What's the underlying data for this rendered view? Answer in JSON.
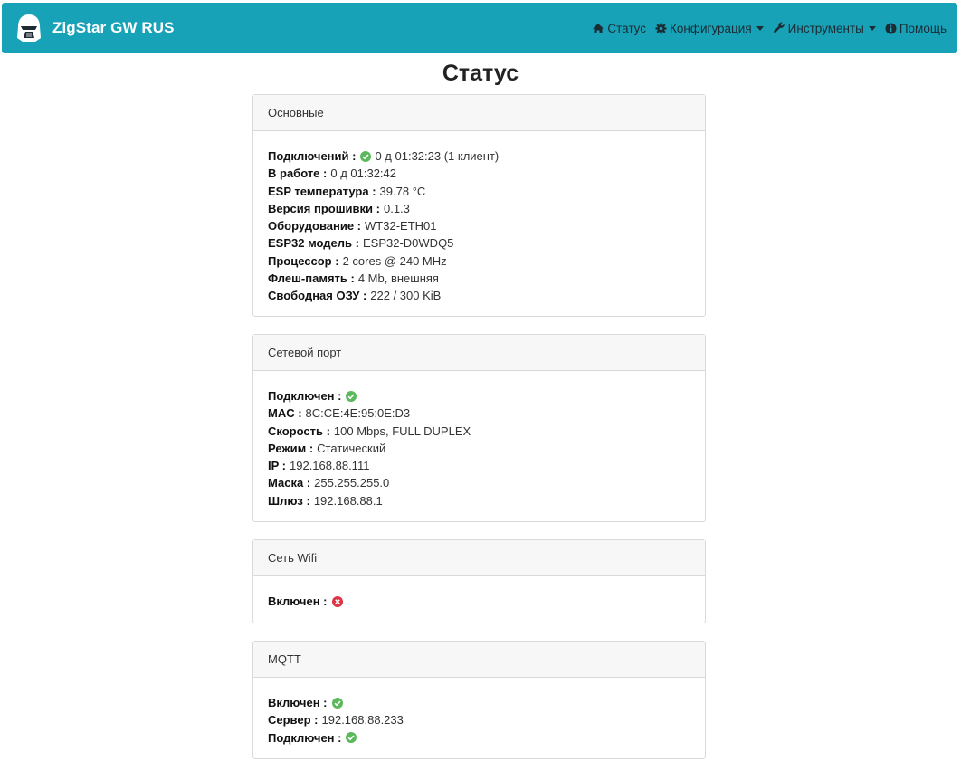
{
  "app": {
    "title": "ZigStar GW RUS"
  },
  "nav": {
    "status": "Статус",
    "config": "Конфигурация",
    "tools": "Инструменты",
    "help": "Помощь"
  },
  "page": {
    "title": "Статус"
  },
  "main_card": {
    "title": "Основные",
    "rows": [
      {
        "label": "Подключений :",
        "status": "ok",
        "value": "0 д 01:32:23 (1 клиент)"
      },
      {
        "label": "В работе :",
        "value": "0 д 01:32:42"
      },
      {
        "label": "ESP температура :",
        "value": "39.78 °C"
      },
      {
        "label": "Версия прошивки :",
        "value": "0.1.3"
      },
      {
        "label": "Оборудование :",
        "value": "WT32-ETH01"
      },
      {
        "label": "ESP32 модель :",
        "value": "ESP32-D0WDQ5"
      },
      {
        "label": "Процессор :",
        "value": "2 cores @ 240 MHz"
      },
      {
        "label": "Флеш-память :",
        "value": "4 Mb, внешняя"
      },
      {
        "label": "Свободная ОЗУ :",
        "value": "222 / 300 KiB"
      }
    ]
  },
  "eth_card": {
    "title": "Сетевой порт",
    "rows": [
      {
        "label": "Подключен :",
        "status": "ok"
      },
      {
        "label": "MAC :",
        "value": "8C:CE:4E:95:0E:D3"
      },
      {
        "label": "Скорость :",
        "value": "100 Mbps, FULL DUPLEX"
      },
      {
        "label": "Режим :",
        "value": "Статический"
      },
      {
        "label": "IP :",
        "value": "192.168.88.111"
      },
      {
        "label": "Маска :",
        "value": "255.255.255.0"
      },
      {
        "label": "Шлюз :",
        "value": "192.168.88.1"
      }
    ]
  },
  "wifi_card": {
    "title": "Сеть Wifi",
    "rows": [
      {
        "label": "Включен :",
        "status": "error"
      }
    ]
  },
  "mqtt_card": {
    "title": "MQTT",
    "rows": [
      {
        "label": "Включен :",
        "status": "ok"
      },
      {
        "label": "Сервер :",
        "value": "192.168.88.233"
      },
      {
        "label": "Подключен :",
        "status": "ok"
      }
    ]
  },
  "colors": {
    "navbar": "#17a2b8",
    "ok": "#5cb85c",
    "error": "#dc3545"
  },
  "icons": {
    "ok": "check-circle-icon",
    "error": "x-circle-icon"
  }
}
